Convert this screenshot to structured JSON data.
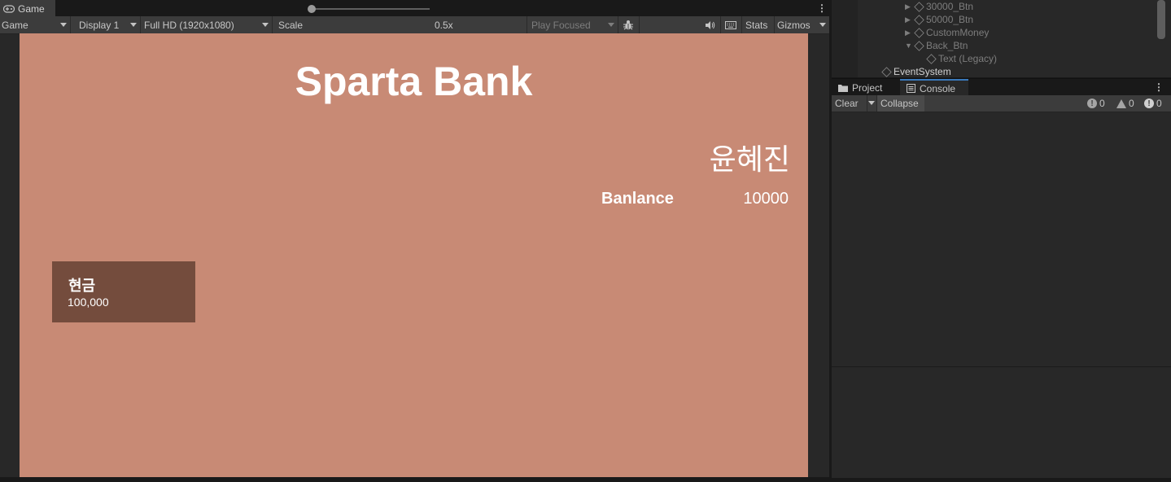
{
  "game": {
    "tab_label": "Game",
    "toolbar": {
      "mode": "Game",
      "display": "Display 1",
      "resolution": "Full HD (1920x1080)",
      "scale_label": "Scale",
      "scale_value": "0.5x",
      "play_mode": "Play Focused",
      "stats": "Stats",
      "gizmos": "Gizmos"
    },
    "viewport": {
      "title": "Sparta Bank",
      "user_name": "윤혜진",
      "balance_label": "Banlance",
      "balance_value": "10000",
      "cash_label": "현금",
      "cash_value": "100,000"
    }
  },
  "hierarchy": {
    "items": [
      {
        "label": "30000_Btn",
        "arrow": "▶"
      },
      {
        "label": "50000_Btn",
        "arrow": "▶"
      },
      {
        "label": "CustomMoney",
        "arrow": "▶"
      },
      {
        "label": "Back_Btn",
        "arrow": "▼"
      },
      {
        "label": "Text (Legacy)",
        "arrow": ""
      },
      {
        "label": "EventSystem",
        "arrow": ""
      }
    ]
  },
  "console": {
    "tabs": [
      {
        "label": "Project"
      },
      {
        "label": "Console"
      }
    ],
    "toolbar": {
      "clear": "Clear",
      "collapse": "Collapse",
      "log_count": "0",
      "warning_count": "0",
      "error_count": "0"
    }
  },
  "colors": {
    "viewport_bg": "#c88a75",
    "cash_card_bg": "#744c3d",
    "editor_bg": "#282828",
    "toolbar_bg": "#3c3c3c",
    "tab_accent": "#3a79bb"
  }
}
